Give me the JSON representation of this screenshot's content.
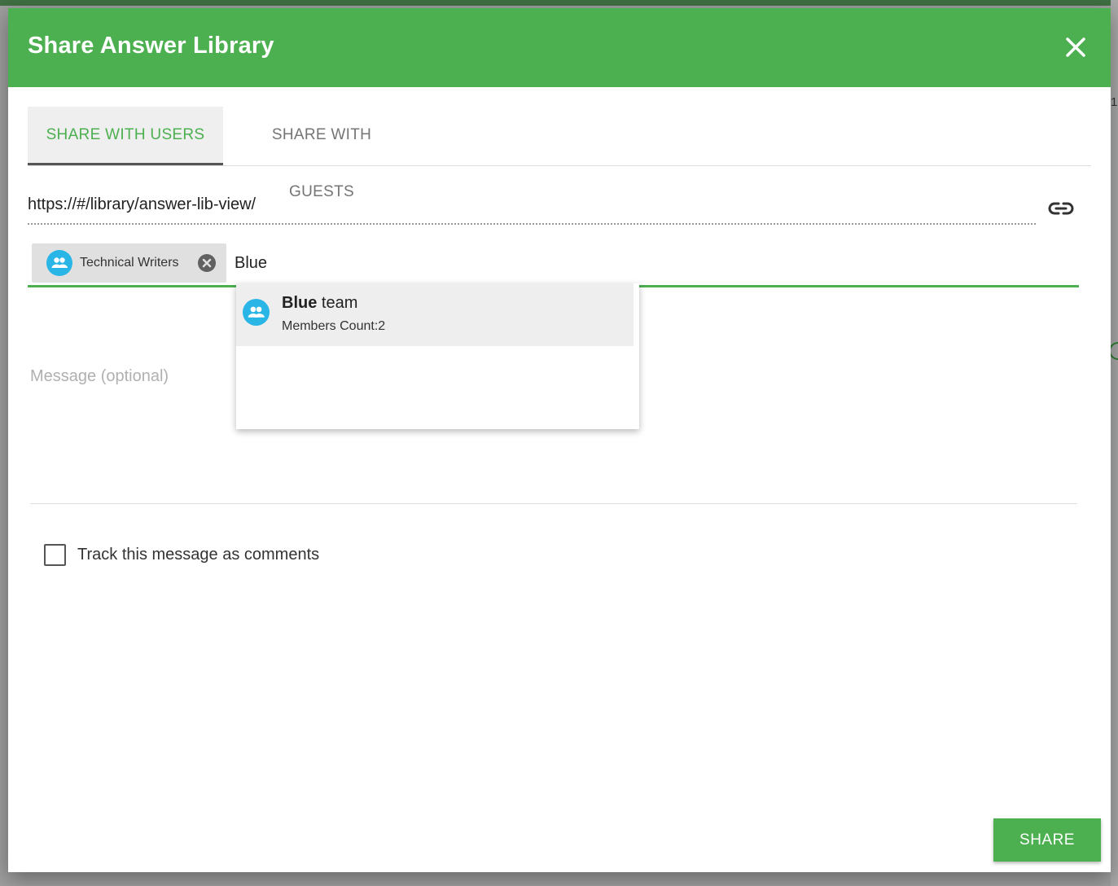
{
  "dialog": {
    "title": "Share Answer Library"
  },
  "tabs": [
    {
      "label": "SHARE WITH USERS",
      "active": true
    },
    {
      "label": "SHARE WITH GUESTS",
      "active": false
    }
  ],
  "share_link": {
    "url": "https://#/library/answer-lib-view/"
  },
  "recipients": {
    "chips": [
      {
        "label": "Technical Writers",
        "icon": "group-icon"
      }
    ],
    "input_value": "Blue"
  },
  "suggestions": [
    {
      "match": "Blue",
      "rest": " team",
      "members": "Members Count:2",
      "icon": "group-icon"
    }
  ],
  "message": {
    "placeholder": "Message (optional)"
  },
  "track_checkbox": {
    "label": "Track this message as comments",
    "checked": false
  },
  "actions": {
    "share_label": "SHARE"
  },
  "colors": {
    "accent": "#4caf50",
    "avatar": "#29b6e6"
  }
}
